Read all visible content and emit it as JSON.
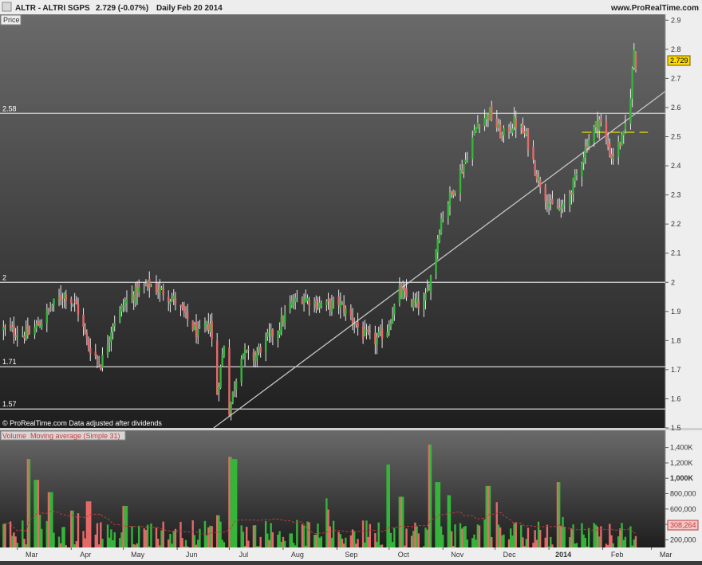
{
  "header": {
    "symbol": "ALTR - ALTRI SGPS",
    "price": "2.729 (-0.07%)",
    "period": "Daily",
    "date": "Feb 20 2014",
    "site": "www.ProRealTime.com"
  },
  "price_tab": "Price",
  "current_price_tag": "2.729",
  "footer_note": "© ProRealTime.com  Data adjusted after dividends",
  "volume_legend": {
    "volume": "Volume",
    "ma": "Moving average (Simple 31)"
  },
  "current_ma_tag": "308,264",
  "colors": {
    "up": "#36b53a",
    "down": "#e46a6a",
    "hline": "#d6d6d6",
    "trend": "#c6c6c6",
    "dashed": "#e8e400",
    "ma": "#c03a3a",
    "tag": "#ffd800"
  },
  "chart_data": [
    {
      "type": "candlestick",
      "title": "ALTR - ALTRI SGPS",
      "ylim": [
        1.5,
        2.92
      ],
      "y_ticks": [
        "2.9",
        "2.8",
        "2.7",
        "2.6",
        "2.5",
        "2.4",
        "2.3",
        "2.2",
        "2.1",
        "2",
        "1.9",
        "1.8",
        "1.7",
        "1.6",
        "1.5"
      ],
      "x_ticks": [
        "Mar",
        "Apr",
        "May",
        "Jun",
        "Jul",
        "Aug",
        "Sep",
        "Oct",
        "Nov",
        "Dec",
        "2014",
        "Feb",
        "Mar"
      ],
      "horizontal_levels": [
        {
          "label": "2.58",
          "value": 2.58
        },
        {
          "label": "2",
          "value": 2.0
        },
        {
          "label": "1.71",
          "value": 1.71
        },
        {
          "label": "1.57",
          "value": 1.565
        }
      ],
      "trendline": {
        "from": {
          "date": "2013-07-01",
          "value": 1.54
        },
        "to": {
          "date": "2014-02-20",
          "value": 2.58
        }
      },
      "dashed_level": {
        "value": 2.515,
        "from": "2014-01-20",
        "to": "2014-02-27"
      },
      "last_price": 2.729,
      "series_path": [
        [
          "2013-02-21",
          1.84
        ],
        [
          "2013-02-28",
          1.83
        ],
        [
          "2013-03-07",
          1.82
        ],
        [
          "2013-03-14",
          1.86
        ],
        [
          "2013-03-21",
          1.92
        ],
        [
          "2013-03-28",
          1.96
        ],
        [
          "2013-04-04",
          1.92
        ],
        [
          "2013-04-11",
          1.78
        ],
        [
          "2013-04-18",
          1.72
        ],
        [
          "2013-04-25",
          1.86
        ],
        [
          "2013-05-02",
          1.93
        ],
        [
          "2013-05-09",
          1.97
        ],
        [
          "2013-05-16",
          1.99
        ],
        [
          "2013-05-23",
          1.97
        ],
        [
          "2013-05-30",
          1.94
        ],
        [
          "2013-06-06",
          1.88
        ],
        [
          "2013-06-13",
          1.82
        ],
        [
          "2013-06-20",
          1.86
        ],
        [
          "2013-06-24",
          1.62
        ],
        [
          "2013-06-28",
          1.79
        ],
        [
          "2013-07-01",
          1.56
        ],
        [
          "2013-07-08",
          1.76
        ],
        [
          "2013-07-15",
          1.74
        ],
        [
          "2013-07-22",
          1.8
        ],
        [
          "2013-07-29",
          1.84
        ],
        [
          "2013-08-05",
          1.92
        ],
        [
          "2013-08-12",
          1.95
        ],
        [
          "2013-08-19",
          1.93
        ],
        [
          "2013-08-26",
          1.92
        ],
        [
          "2013-09-02",
          1.93
        ],
        [
          "2013-09-09",
          1.88
        ],
        [
          "2013-09-16",
          1.82
        ],
        [
          "2013-09-23",
          1.8
        ],
        [
          "2013-09-30",
          1.84
        ],
        [
          "2013-10-07",
          1.97
        ],
        [
          "2013-10-14",
          1.93
        ],
        [
          "2013-10-21",
          1.92
        ],
        [
          "2013-10-25",
          2.02
        ],
        [
          "2013-10-31",
          2.22
        ],
        [
          "2013-11-07",
          2.32
        ],
        [
          "2013-11-14",
          2.42
        ],
        [
          "2013-11-21",
          2.55
        ],
        [
          "2013-11-28",
          2.58
        ],
        [
          "2013-12-05",
          2.5
        ],
        [
          "2013-12-12",
          2.55
        ],
        [
          "2013-12-19",
          2.5
        ],
        [
          "2013-12-26",
          2.35
        ],
        [
          "2014-01-02",
          2.26
        ],
        [
          "2014-01-09",
          2.25
        ],
        [
          "2014-01-16",
          2.35
        ],
        [
          "2014-01-23",
          2.48
        ],
        [
          "2014-01-30",
          2.56
        ],
        [
          "2014-02-06",
          2.43
        ],
        [
          "2014-02-13",
          2.5
        ],
        [
          "2014-02-17",
          2.65
        ],
        [
          "2014-02-19",
          2.8
        ],
        [
          "2014-02-20",
          2.729
        ]
      ]
    },
    {
      "type": "bar",
      "title": "Volume",
      "ylim": [
        100000,
        1500000
      ],
      "y_ticks": [
        "1,400K",
        "1,200K",
        "1,000K",
        "800,000",
        "600,000",
        "400,000",
        "200,000"
      ],
      "moving_average_window": 31,
      "base_volume": 320000,
      "spikes": [
        {
          "date": "2013-03-08",
          "value": 1250000
        },
        {
          "date": "2013-03-12",
          "value": 980000
        },
        {
          "date": "2013-03-20",
          "value": 820000
        },
        {
          "date": "2013-04-01",
          "value": 580000
        },
        {
          "date": "2013-04-11",
          "value": 700000
        },
        {
          "date": "2013-05-02",
          "value": 640000
        },
        {
          "date": "2013-06-24",
          "value": 520000
        },
        {
          "date": "2013-07-01",
          "value": 1280000
        },
        {
          "date": "2013-07-04",
          "value": 1250000
        },
        {
          "date": "2013-09-30",
          "value": 1180000
        },
        {
          "date": "2013-10-08",
          "value": 760000
        },
        {
          "date": "2013-10-25",
          "value": 1440000
        },
        {
          "date": "2013-10-29",
          "value": 950000
        },
        {
          "date": "2013-11-04",
          "value": 780000
        },
        {
          "date": "2013-11-27",
          "value": 900000
        },
        {
          "date": "2014-01-06",
          "value": 950000
        }
      ]
    }
  ]
}
